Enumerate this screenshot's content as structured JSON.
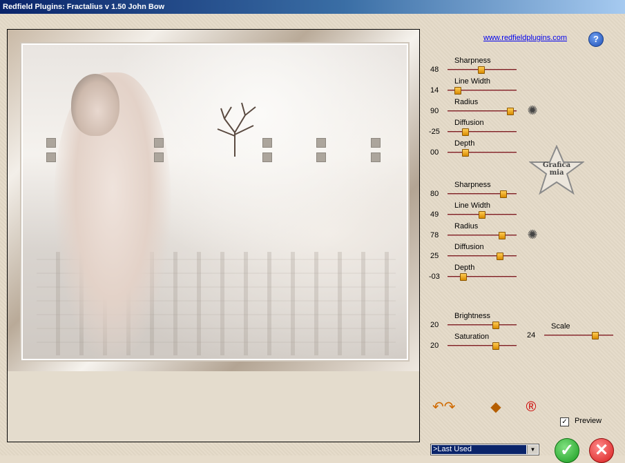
{
  "window": {
    "title": "Redfield Plugins: Fractalius v 1.50   John Bow"
  },
  "header": {
    "link_text": "www.redfieldplugins.com",
    "help_icon": "question-icon",
    "help_text": "?"
  },
  "group1": {
    "sliders": [
      {
        "label": "Sharpness",
        "value": "48"
      },
      {
        "label": "Line Width",
        "value": "14"
      },
      {
        "label": "Radius",
        "value": "90"
      },
      {
        "label": "Diffusion",
        "value": "-25"
      },
      {
        "label": "Depth",
        "value": "00"
      }
    ]
  },
  "group2": {
    "sliders": [
      {
        "label": "Sharpness",
        "value": "80"
      },
      {
        "label": "Line Width",
        "value": "49"
      },
      {
        "label": "Radius",
        "value": "78"
      },
      {
        "label": "Diffusion",
        "value": "25"
      },
      {
        "label": "Depth",
        "value": "-03"
      }
    ]
  },
  "group3": {
    "sliders": [
      {
        "label": "Brightness",
        "value": "20"
      },
      {
        "label": "Saturation",
        "value": "20"
      }
    ],
    "scale": {
      "label": "Scale",
      "value": "24"
    }
  },
  "badge": {
    "text_line1": "Grafica",
    "text_line2": "mia"
  },
  "footer": {
    "preview_label": "Preview",
    "preview_checked": true,
    "preset_value": ">Last Used"
  },
  "colors": {
    "title_start": "#0a246a",
    "title_end": "#a6caf0",
    "panel": "#e4dac8",
    "thumb": "#e89a10",
    "track": "#7a1f1f"
  }
}
